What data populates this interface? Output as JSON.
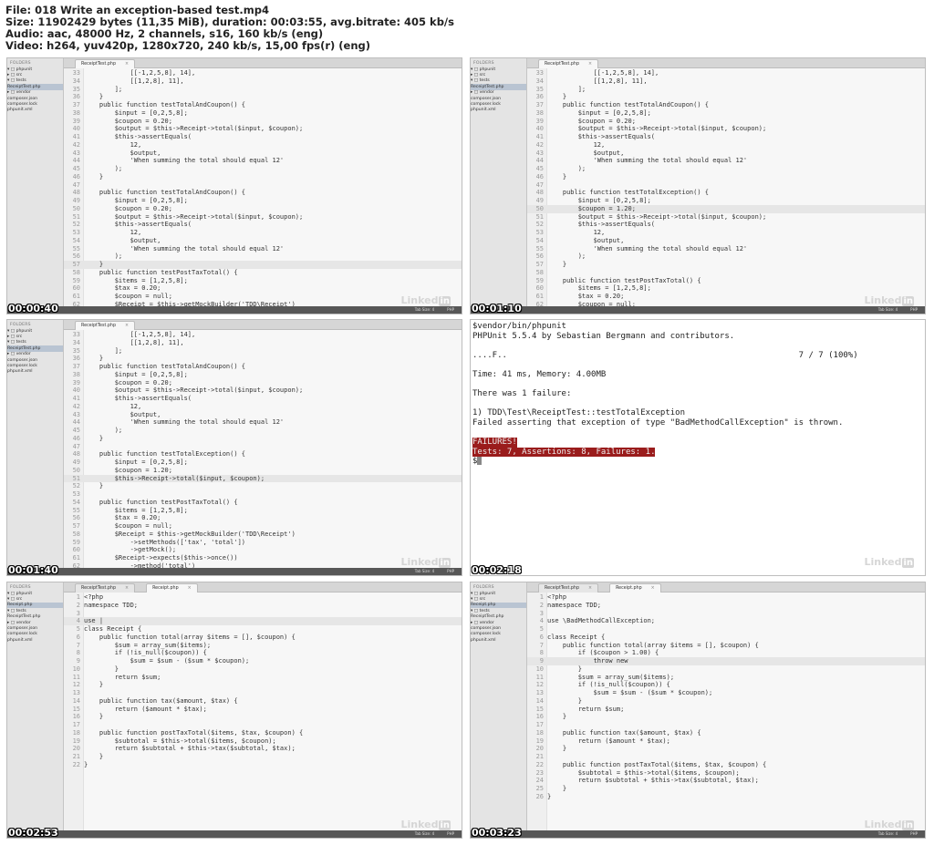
{
  "header": {
    "line1": "File: 018 Write an exception-based test.mp4",
    "line2": "Size: 11902429 bytes (11,35 MiB), duration: 00:03:55, avg.bitrate: 405 kb/s",
    "line3": "Audio: aac, 48000 Hz, 2 channels, s16, 160 kb/s (eng)",
    "line4": "Video: h264, yuv420p, 1280x720, 240 kb/s, 15,00 fps(r) (eng)"
  },
  "editor": {
    "status_tab_size": "Tab Size: 4",
    "status_syntax": "PHP",
    "watermark": "Linked",
    "watermark_badge": "in"
  },
  "sidebar_a": {
    "heading": "FOLDERS",
    "items": [
      {
        "label": "▾ □ phpunit"
      },
      {
        "label": "  ▸ □ src"
      },
      {
        "label": "  ▾ □ tests"
      },
      {
        "label": "        ReceiptTest.php"
      },
      {
        "label": "  ▸ □ vendor"
      },
      {
        "label": "      composer.json"
      },
      {
        "label": "      composer.lock"
      },
      {
        "label": "      phpunit.xml"
      }
    ]
  },
  "sidebar_b": {
    "heading": "FOLDERS",
    "items": [
      {
        "label": "▾ □ phpunit"
      },
      {
        "label": "  ▾ □ src"
      },
      {
        "label": "        Receipt.php"
      },
      {
        "label": "  ▾ □ tests"
      },
      {
        "label": "        ReceiptTest.php"
      },
      {
        "label": "  ▸ □ vendor"
      },
      {
        "label": "      composer.json"
      },
      {
        "label": "      composer.lock"
      },
      {
        "label": "      phpunit.xml"
      }
    ]
  },
  "frames": [
    {
      "timestamp": "00:00:40",
      "tabs": [
        {
          "label": "ReceiptTest.php",
          "close": "×"
        }
      ],
      "lines": [
        {
          "n": "33",
          "t": "            [[-1,2,5,8], 14],"
        },
        {
          "n": "34",
          "t": "            [[1,2,8], 11],"
        },
        {
          "n": "35",
          "t": "        ];"
        },
        {
          "n": "36",
          "t": "    }"
        },
        {
          "n": "37",
          "t": "    public function testTotalAndCoupon() {"
        },
        {
          "n": "38",
          "t": "        $input = [0,2,5,8];"
        },
        {
          "n": "39",
          "t": "        $coupon = 0.20;"
        },
        {
          "n": "40",
          "t": "        $output = $this->Receipt->total($input, $coupon);"
        },
        {
          "n": "41",
          "t": "        $this->assertEquals("
        },
        {
          "n": "42",
          "t": "            12,"
        },
        {
          "n": "43",
          "t": "            $output,"
        },
        {
          "n": "44",
          "t": "            'When summing the total should equal 12'"
        },
        {
          "n": "45",
          "t": "        );"
        },
        {
          "n": "46",
          "t": "    }"
        },
        {
          "n": "47",
          "t": ""
        },
        {
          "n": "48",
          "t": "    public function testTotalAndCoupon() {"
        },
        {
          "n": "49",
          "t": "        $input = [0,2,5,8];"
        },
        {
          "n": "50",
          "t": "        $coupon = 0.20;"
        },
        {
          "n": "51",
          "t": "        $output = $this->Receipt->total($input, $coupon);"
        },
        {
          "n": "52",
          "t": "        $this->assertEquals("
        },
        {
          "n": "53",
          "t": "            12,"
        },
        {
          "n": "54",
          "t": "            $output,"
        },
        {
          "n": "55",
          "t": "            'When summing the total should equal 12'"
        },
        {
          "n": "56",
          "t": "        );"
        },
        {
          "n": "57",
          "t": "    }",
          "hl": true
        },
        {
          "n": "58",
          "t": "    public function testPostTaxTotal() {"
        },
        {
          "n": "59",
          "t": "        $items = [1,2,5,8];"
        },
        {
          "n": "60",
          "t": "        $tax = 0.20;"
        },
        {
          "n": "61",
          "t": "        $coupon = null;"
        },
        {
          "n": "62",
          "t": "        $Receipt = $this->getMockBuilder('TDD\\Receipt')"
        }
      ]
    },
    {
      "timestamp": "00:01:10",
      "tabs": [
        {
          "label": "ReceiptTest.php",
          "close": "×"
        }
      ],
      "lines": [
        {
          "n": "33",
          "t": "            [[-1,2,5,8], 14],"
        },
        {
          "n": "34",
          "t": "            [[1,2,8], 11],"
        },
        {
          "n": "35",
          "t": "        ];"
        },
        {
          "n": "36",
          "t": "    }"
        },
        {
          "n": "37",
          "t": "    public function testTotalAndCoupon() {"
        },
        {
          "n": "38",
          "t": "        $input = [0,2,5,8];"
        },
        {
          "n": "39",
          "t": "        $coupon = 0.20;"
        },
        {
          "n": "40",
          "t": "        $output = $this->Receipt->total($input, $coupon);"
        },
        {
          "n": "41",
          "t": "        $this->assertEquals("
        },
        {
          "n": "42",
          "t": "            12,"
        },
        {
          "n": "43",
          "t": "            $output,"
        },
        {
          "n": "44",
          "t": "            'When summing the total should equal 12'"
        },
        {
          "n": "45",
          "t": "        );"
        },
        {
          "n": "46",
          "t": "    }"
        },
        {
          "n": "47",
          "t": ""
        },
        {
          "n": "48",
          "t": "    public function testTotalException() {"
        },
        {
          "n": "49",
          "t": "        $input = [0,2,5,8];"
        },
        {
          "n": "50",
          "t": "        $coupon = 1.20;",
          "hl": true
        },
        {
          "n": "51",
          "t": "        $output = $this->Receipt->total($input, $coupon);"
        },
        {
          "n": "52",
          "t": "        $this->assertEquals("
        },
        {
          "n": "53",
          "t": "            12,"
        },
        {
          "n": "54",
          "t": "            $output,"
        },
        {
          "n": "55",
          "t": "            'When summing the total should equal 12'"
        },
        {
          "n": "56",
          "t": "        );"
        },
        {
          "n": "57",
          "t": "    }"
        },
        {
          "n": "58",
          "t": ""
        },
        {
          "n": "59",
          "t": "    public function testPostTaxTotal() {"
        },
        {
          "n": "60",
          "t": "        $items = [1,2,5,8];"
        },
        {
          "n": "61",
          "t": "        $tax = 0.20;"
        },
        {
          "n": "62",
          "t": "        $coupon = null;"
        }
      ]
    },
    {
      "timestamp": "00:01:40",
      "tabs": [
        {
          "label": "ReceiptTest.php",
          "close": "×"
        }
      ],
      "lines": [
        {
          "n": "33",
          "t": "            [[-1,2,5,8], 14],"
        },
        {
          "n": "34",
          "t": "            [[1,2,8], 11],"
        },
        {
          "n": "35",
          "t": "        ];"
        },
        {
          "n": "36",
          "t": "    }"
        },
        {
          "n": "37",
          "t": "    public function testTotalAndCoupon() {"
        },
        {
          "n": "38",
          "t": "        $input = [0,2,5,8];"
        },
        {
          "n": "39",
          "t": "        $coupon = 0.20;"
        },
        {
          "n": "40",
          "t": "        $output = $this->Receipt->total($input, $coupon);"
        },
        {
          "n": "41",
          "t": "        $this->assertEquals("
        },
        {
          "n": "42",
          "t": "            12,"
        },
        {
          "n": "43",
          "t": "            $output,"
        },
        {
          "n": "44",
          "t": "            'When summing the total should equal 12'"
        },
        {
          "n": "45",
          "t": "        );"
        },
        {
          "n": "46",
          "t": "    }"
        },
        {
          "n": "47",
          "t": ""
        },
        {
          "n": "48",
          "t": "    public function testTotalException() {"
        },
        {
          "n": "49",
          "t": "        $input = [0,2,5,8];"
        },
        {
          "n": "50",
          "t": "        $coupon = 1.20;"
        },
        {
          "n": "51",
          "t": "        $this->Receipt->total($input, $coupon);",
          "hl": true
        },
        {
          "n": "52",
          "t": "    }"
        },
        {
          "n": "53",
          "t": ""
        },
        {
          "n": "54",
          "t": "    public function testPostTaxTotal() {"
        },
        {
          "n": "55",
          "t": "        $items = [1,2,5,8];"
        },
        {
          "n": "56",
          "t": "        $tax = 0.20;"
        },
        {
          "n": "57",
          "t": "        $coupon = null;"
        },
        {
          "n": "58",
          "t": "        $Receipt = $this->getMockBuilder('TDD\\Receipt')"
        },
        {
          "n": "59",
          "t": "            ->setMethods(['tax', 'total'])"
        },
        {
          "n": "60",
          "t": "            ->getMock();"
        },
        {
          "n": "61",
          "t": "        $Receipt->expects($this->once())"
        },
        {
          "n": "62",
          "t": "            ->method('total')"
        }
      ]
    },
    {
      "timestamp": "00:02:18",
      "terminal": [
        "$vendor/bin/phpunit",
        "PHPUnit 5.5.4 by Sebastian Bergmann and contributors.",
        "",
        "....F..                                                           7 / 7 (100%)",
        "",
        "Time: 41 ms, Memory: 4.00MB",
        "",
        "There was 1 failure:",
        "",
        "1) TDD\\Test\\ReceiptTest::testTotalException",
        "Failed asserting that exception of type \"BadMethodCallException\" is thrown.",
        ""
      ],
      "fail1": "FAILURES!",
      "fail2": "Tests: 7, Assertions: 8, Failures: 1.",
      "prompt": "$"
    },
    {
      "timestamp": "00:02:53",
      "tabs": [
        {
          "label": "ReceiptTest.php",
          "close": "×"
        },
        {
          "label": "Receipt.php",
          "close": "×"
        }
      ],
      "lines": [
        {
          "n": "1",
          "t": "<?php"
        },
        {
          "n": "2",
          "t": "namespace TDD;"
        },
        {
          "n": "3",
          "t": ""
        },
        {
          "n": "4",
          "t": "use |",
          "hl": true
        },
        {
          "n": "5",
          "t": "class Receipt {"
        },
        {
          "n": "6",
          "t": "    public function total(array $items = [], $coupon) {"
        },
        {
          "n": "7",
          "t": "        $sum = array_sum($items);"
        },
        {
          "n": "8",
          "t": "        if (!is_null($coupon)) {"
        },
        {
          "n": "9",
          "t": "            $sum = $sum - ($sum * $coupon);"
        },
        {
          "n": "10",
          "t": "        }"
        },
        {
          "n": "11",
          "t": "        return $sum;"
        },
        {
          "n": "12",
          "t": "    }"
        },
        {
          "n": "13",
          "t": ""
        },
        {
          "n": "14",
          "t": "    public function tax($amount, $tax) {"
        },
        {
          "n": "15",
          "t": "        return ($amount * $tax);"
        },
        {
          "n": "16",
          "t": "    }"
        },
        {
          "n": "17",
          "t": ""
        },
        {
          "n": "18",
          "t": "    public function postTaxTotal($items, $tax, $coupon) {"
        },
        {
          "n": "19",
          "t": "        $subtotal = $this->total($items, $coupon);"
        },
        {
          "n": "20",
          "t": "        return $subtotal + $this->tax($subtotal, $tax);"
        },
        {
          "n": "21",
          "t": "    }"
        },
        {
          "n": "22",
          "t": "}"
        }
      ]
    },
    {
      "timestamp": "00:03:23",
      "tabs": [
        {
          "label": "ReceiptTest.php",
          "close": "×"
        },
        {
          "label": "Receipt.php",
          "close": "×"
        }
      ],
      "lines": [
        {
          "n": "1",
          "t": "<?php"
        },
        {
          "n": "2",
          "t": "namespace TDD;"
        },
        {
          "n": "3",
          "t": ""
        },
        {
          "n": "4",
          "t": "use \\BadMethodCallException;"
        },
        {
          "n": "5",
          "t": ""
        },
        {
          "n": "6",
          "t": "class Receipt {"
        },
        {
          "n": "7",
          "t": "    public function total(array $items = [], $coupon) {"
        },
        {
          "n": "8",
          "t": "        if ($coupon > 1.00) {"
        },
        {
          "n": "9",
          "t": "            throw new",
          "hl": true
        },
        {
          "n": "10",
          "t": "        }"
        },
        {
          "n": "11",
          "t": "        $sum = array_sum($items);"
        },
        {
          "n": "12",
          "t": "        if (!is_null($coupon)) {"
        },
        {
          "n": "13",
          "t": "            $sum = $sum - ($sum * $coupon);"
        },
        {
          "n": "14",
          "t": "        }"
        },
        {
          "n": "15",
          "t": "        return $sum;"
        },
        {
          "n": "16",
          "t": "    }"
        },
        {
          "n": "17",
          "t": ""
        },
        {
          "n": "18",
          "t": "    public function tax($amount, $tax) {"
        },
        {
          "n": "19",
          "t": "        return ($amount * $tax);"
        },
        {
          "n": "20",
          "t": "    }"
        },
        {
          "n": "21",
          "t": ""
        },
        {
          "n": "22",
          "t": "    public function postTaxTotal($items, $tax, $coupon) {"
        },
        {
          "n": "23",
          "t": "        $subtotal = $this->total($items, $coupon);"
        },
        {
          "n": "24",
          "t": "        return $subtotal + $this->tax($subtotal, $tax);"
        },
        {
          "n": "25",
          "t": "    }"
        },
        {
          "n": "26",
          "t": "}"
        }
      ]
    }
  ]
}
